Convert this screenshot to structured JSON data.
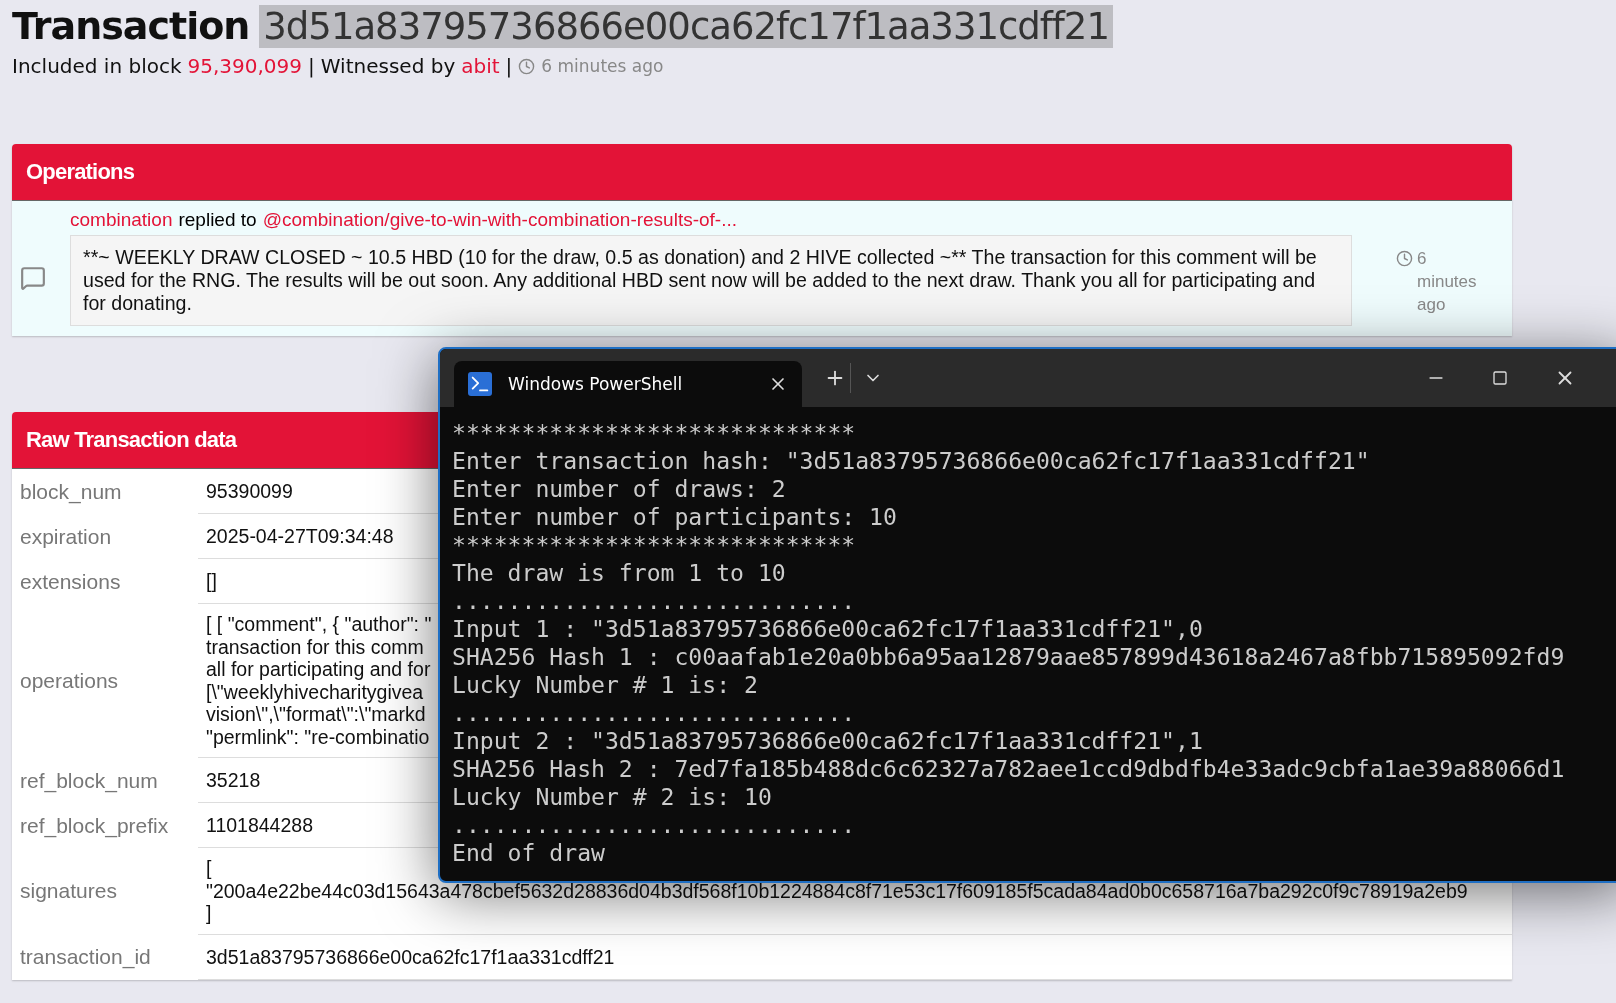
{
  "header": {
    "title": "Transaction",
    "hash": "3d51a83795736866e00ca62fc17f1aa331cdff21",
    "included_label": "Included in block",
    "block": "95,390,099",
    "separator_1": "|",
    "witnessed_label": "Witnessed by",
    "witness": "abit",
    "separator_2": "|",
    "time": "6 minutes ago"
  },
  "operations": {
    "title": "Operations",
    "items": [
      {
        "author": "combination",
        "action": "replied to",
        "target": "@combination/give-to-win-with-combination-results-of-...",
        "body": "**~ WEEKLY DRAW CLOSED ~ 10.5 HBD (10 for the draw, 0.5 as donation) and 2 HIVE collected ~** The transaction for this comment will be used for the RNG. The results will be out soon. Any additional HBD sent now will be added to the next draw. Thank you all for participating and for donating.",
        "time": "6 minutes ago"
      }
    ]
  },
  "raw": {
    "title": "Raw Transaction data",
    "rows": [
      {
        "key": "block_num",
        "lines": [
          "95390099"
        ]
      },
      {
        "key": "expiration",
        "lines": [
          "2025-04-27T09:34:48"
        ]
      },
      {
        "key": "extensions",
        "lines": [
          "[]"
        ]
      },
      {
        "key": "operations",
        "lines": [
          "[ [ \"comment\", { \"author\": \"",
          "transaction for this comm",
          "all for participating and for",
          "[\\\"weeklyhivecharitygivea",
          "vision\\\",\\\"format\\\":\\\"markd",
          "\"permlink\": \"re-combinatio"
        ]
      },
      {
        "key": "ref_block_num",
        "lines": [
          "35218"
        ]
      },
      {
        "key": "ref_block_prefix",
        "lines": [
          "1101844288"
        ]
      },
      {
        "key": "signatures",
        "lines": [
          "[",
          "\"200a4e22be44c03d15643a478cbef5632d28836d04b3df568f10b1224884c8f71e53c17f609185f5cada84ad0b0c658716a7ba292c0f9c78919a2eb9",
          "]"
        ]
      },
      {
        "key": "transaction_id",
        "lines": [
          "3d51a83795736866e00ca62fc17f1aa331cdff21"
        ]
      }
    ]
  },
  "terminal": {
    "tab_title": "Windows PowerShell",
    "lines": [
      "*****************************",
      "Enter transaction hash: \"3d51a83795736866e00ca62fc17f1aa331cdff21\"",
      "Enter number of draws: 2",
      "Enter number of participants: 10",
      "*****************************",
      "The draw is from 1 to 10",
      ".............................",
      "Input 1 : \"3d51a83795736866e00ca62fc17f1aa331cdff21\",0",
      "SHA256 Hash 1 : c00aafab1e20a0bb6a95aa12879aae857899d43618a2467a8fbb715895092fd9",
      "Lucky Number # 1 is: 2",
      ".............................",
      "Input 2 : \"3d51a83795736866e00ca62fc17f1aa331cdff21\",1",
      "SHA256 Hash 2 : 7ed7fa185b488dc6c62327a782aee1ccd9dbdfb4e33adc9cbfa1ae39a88066d1",
      "Lucky Number # 2 is: 10",
      ".............................",
      "End of draw"
    ]
  }
}
